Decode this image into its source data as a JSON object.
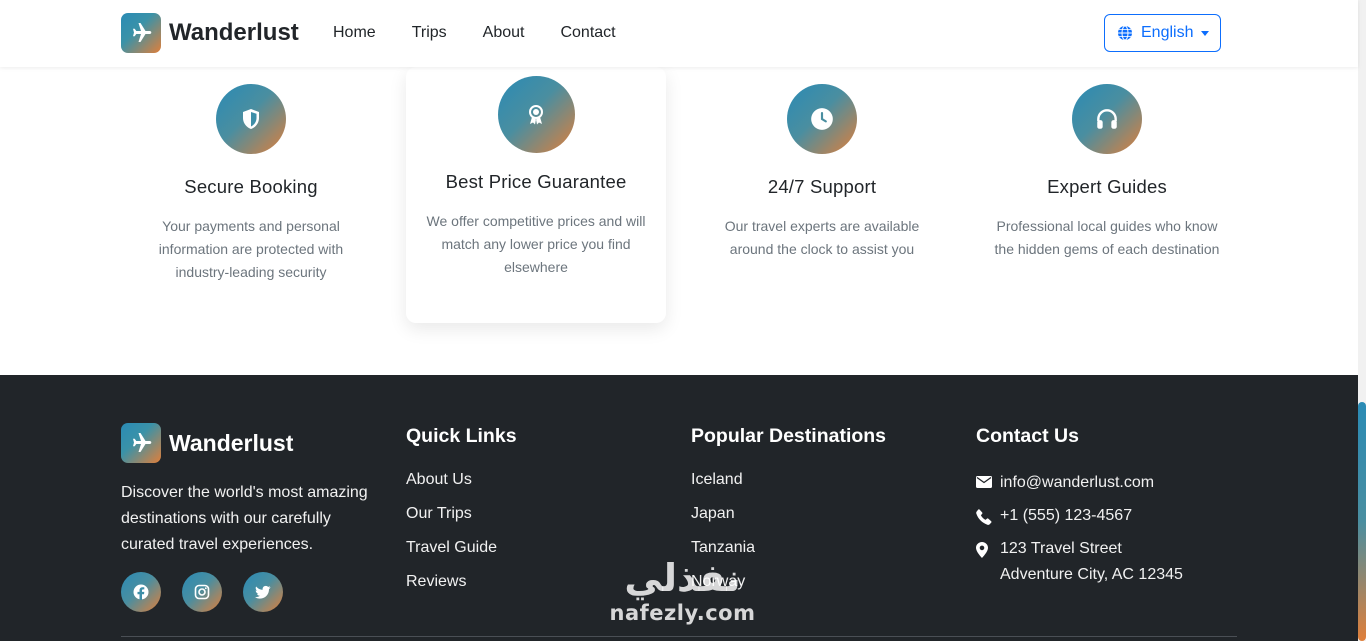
{
  "brand": {
    "name": "Wanderlust"
  },
  "nav": {
    "links": [
      "Home",
      "Trips",
      "About",
      "Contact"
    ],
    "language": "English"
  },
  "features": [
    {
      "icon": "shield-icon",
      "title": "Secure Booking",
      "desc": "Your payments and personal information are protected with industry-leading security"
    },
    {
      "icon": "award-icon",
      "title": "Best Price Guarantee",
      "desc": "We offer competitive prices and will match any lower price you find elsewhere"
    },
    {
      "icon": "clock-icon",
      "title": "24/7 Support",
      "desc": "Our travel experts are available around the clock to assist you"
    },
    {
      "icon": "headphones-icon",
      "title": "Expert Guides",
      "desc": "Professional local guides who know the hidden gems of each destination"
    }
  ],
  "footer": {
    "brand_name": "Wanderlust",
    "description": "Discover the world's most amazing destinations with our carefully curated travel experiences.",
    "socials": [
      "facebook-icon",
      "instagram-icon",
      "twitter-icon"
    ],
    "quick_links": {
      "title": "Quick Links",
      "items": [
        "About Us",
        "Our Trips",
        "Travel Guide",
        "Reviews"
      ]
    },
    "destinations": {
      "title": "Popular Destinations",
      "items": [
        "Iceland",
        "Japan",
        "Tanzania",
        "Norway"
      ]
    },
    "contact": {
      "title": "Contact Us",
      "email": "info@wanderlust.com",
      "phone": "+1 (555) 123-4567",
      "address_line1": "123 Travel Street",
      "address_line2": "Adventure City, AC 12345"
    }
  },
  "watermark": {
    "arabic": "نفذلي",
    "latin": "nafezly.com"
  },
  "colors": {
    "accent": "#0d6efd",
    "gradient_start": "#2a8bb5",
    "gradient_end": "#e07f3a",
    "footer_bg": "#212529"
  }
}
